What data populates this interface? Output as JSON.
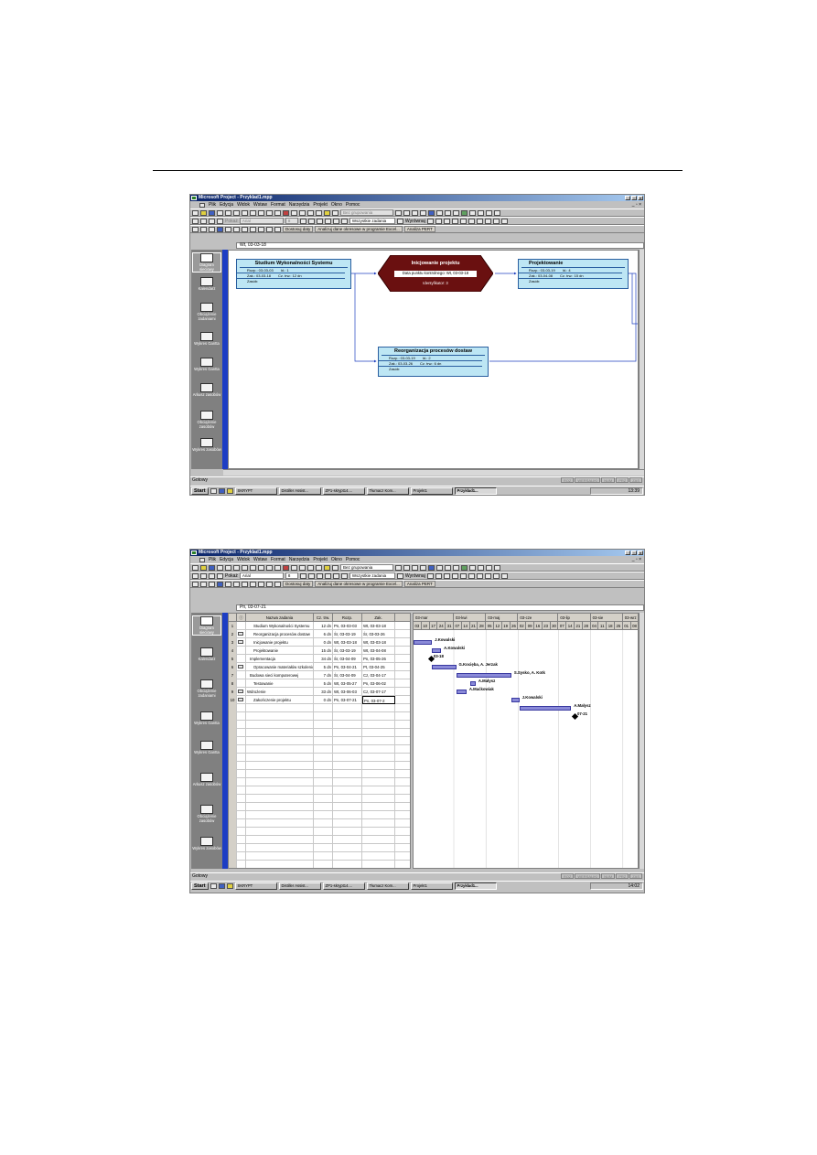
{
  "app": {
    "title": "Microsoft Project - Przyklad1.mpp"
  },
  "menu": [
    "Plik",
    "Edycja",
    "Widok",
    "Wstaw",
    "Format",
    "Narzędzia",
    "Projekt",
    "Okno",
    "Pomoc"
  ],
  "toolbar": {
    "grouping": "Bez grupowania",
    "link_label": "Pokaż",
    "font": "Arial",
    "font_size": "8",
    "filter": "Wszystkie zadania",
    "align_label": "Wyrównaj",
    "adjust_dates": "Dostosuj daty",
    "analyze": "Analizuj dane okresowe w programie Excel...",
    "pert": "Analiza PERT"
  },
  "views": [
    "Diagram sieciowy",
    "Kalendarz",
    "Obciążenie zadaniami",
    "Wykres Gantta",
    "Wykres Gantta",
    "Arkusz zasobów",
    "Obciążenie zasobów",
    "Wykres zasobów"
  ],
  "screen1": {
    "entry_value": "Wt, 03-03-18",
    "nodes": [
      {
        "title": "Studium Wykonalności Systemu",
        "start": "Rozp.: 03-03-03",
        "id": "Id.: 1",
        "end": "Zak.: 03-03-18",
        "dur": "Cz. trw.: 12 dn",
        "res": "Zasób:"
      },
      {
        "title": "Projektowanie",
        "start": "Rozp.: 03-03-19",
        "id": "Id.: 4",
        "end": "Zak.: 03-04-08",
        "dur": "Cz. trw.: 15 dn",
        "res": "Zasób:"
      },
      {
        "title": "Reorganizacja procesów dostaw",
        "start": "Rozp.: 03-03-19",
        "id": "Id.: 2",
        "end": "Zak.: 03-03-26",
        "dur": "Cz. trw.: 6 dn",
        "res": "Zasób:"
      }
    ],
    "milestone": {
      "title": "Inicjowanie projektu",
      "field": "Data punktu kontrolnego: Wt, 03-03-18",
      "id": "Identyfikator: 3"
    },
    "status": "Gotowy",
    "clock": "13:39"
  },
  "screen2": {
    "entry_value": "Pn, 03-07-21",
    "columns": [
      "",
      "Nazwa zadania",
      "Cz. trw.",
      "Rozp.",
      "Zak."
    ],
    "tasks": [
      {
        "n": "1",
        "name": "Studium Wykonalności Systemu",
        "dur": "12 dn",
        "start": "Pn, 03-03-03",
        "end": "Wt, 03-03-18"
      },
      {
        "n": "2",
        "name": "Reorganizacja procesów dostaw",
        "dur": "6 dn",
        "start": "Śr, 03-03-19",
        "end": "Śr, 03-03-26"
      },
      {
        "n": "3",
        "name": "Inicjowanie projektu",
        "dur": "0 dn",
        "start": "Wt, 03-03-18",
        "end": "Wt, 03-03-18"
      },
      {
        "n": "4",
        "name": "Projektowanie",
        "dur": "15 dn",
        "start": "Śr, 03-03-19",
        "end": "Wt, 03-04-08"
      },
      {
        "n": "5",
        "name": "Implementacja",
        "dur": "34 dn",
        "start": "Śr, 03-04-09",
        "end": "Pn, 03-05-26"
      },
      {
        "n": "6",
        "name": "Opracowanie materiałów szkolenio",
        "dur": "5 dn",
        "start": "Pn, 03-04-21",
        "end": "Pt, 03-04-25"
      },
      {
        "n": "7",
        "name": "Budowa sieci komputerowej",
        "dur": "7 dn",
        "start": "Śr, 03-04-09",
        "end": "Cz, 03-04-17"
      },
      {
        "n": "8",
        "name": "Testowanie",
        "dur": "5 dn",
        "start": "Wt, 03-05-27",
        "end": "Pn, 03-06-02"
      },
      {
        "n": "9",
        "name": "Wdrożenie",
        "dur": "33 dn",
        "start": "Wt, 03-06-03",
        "end": "Cz, 03-07-17"
      },
      {
        "n": "10",
        "name": "Zakończenie projektu",
        "dur": "0 dn",
        "start": "Pn, 03-07-21",
        "end": "Pn, 03-07-2"
      }
    ],
    "months": [
      "03-mar",
      "03-kwi",
      "03-maj",
      "03-cze",
      "03-lip",
      "03-sie",
      "03-wrz"
    ],
    "days": [
      "03",
      "10",
      "17",
      "24",
      "31",
      "07",
      "14",
      "21",
      "28",
      "05",
      "12",
      "19",
      "26",
      "02",
      "09",
      "16",
      "23",
      "30",
      "07",
      "14",
      "21",
      "28",
      "04",
      "11",
      "18",
      "25",
      "01",
      "08"
    ],
    "bar_labels": [
      "J.Kowalski",
      "A.Kowalski",
      "03-18",
      "G.Kocięba, A. Jerzak",
      "S.Sysko, A. Kotk",
      "A.Małysz",
      "A.Maćkowiak",
      "J.Kowalski",
      "A.Małysz",
      "07-21"
    ],
    "status": "Gotowy",
    "clock": "14:02"
  },
  "statusbar_ind": [
    "ROZ",
    "WERSALIKI",
    "NUM",
    "PRZ",
    "ZAS"
  ],
  "taskbar": {
    "start": "Start",
    "items": [
      "SKRYPT",
      "Distiller Assist...",
      "ZP1-skrypt14....",
      "Tłumacz Kom...",
      "Projekt1",
      "Przykład1..."
    ]
  }
}
